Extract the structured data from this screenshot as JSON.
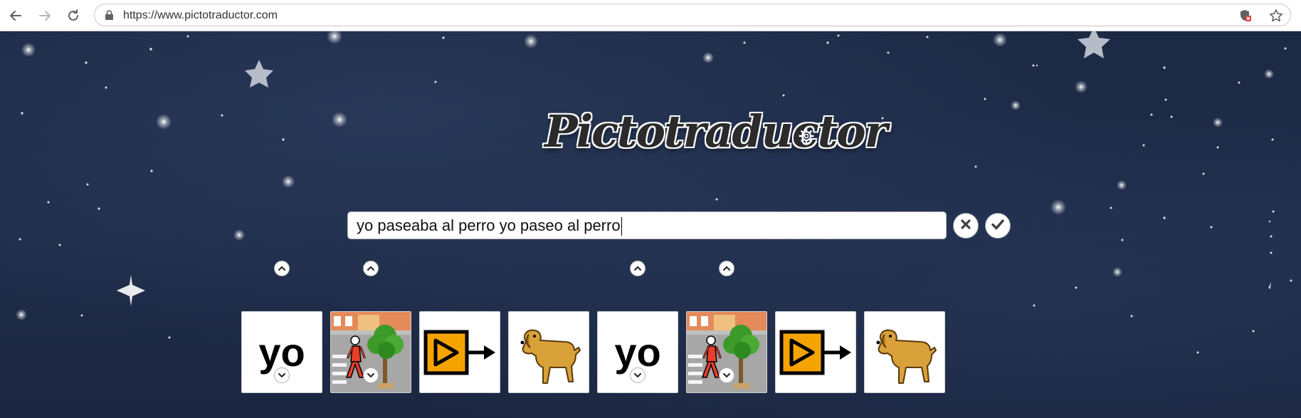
{
  "browser": {
    "url": "https://www.pictotraductor.com",
    "icons": [
      "back-arrow-icon",
      "forward-arrow-icon",
      "reload-icon",
      "lock-icon",
      "shield-extension-icon",
      "bookmark-star-icon"
    ]
  },
  "logo": {
    "text": "Pictotraductor"
  },
  "search": {
    "value": "yo paseaba al perro yo paseo al perro",
    "clear_icon": "close-icon",
    "submit_icon": "checkmark-icon"
  },
  "pictograms": [
    {
      "type": "text",
      "word": "yo"
    },
    {
      "type": "image",
      "depicts": "person-walking-street"
    },
    {
      "type": "image",
      "depicts": "past-tense-arrow"
    },
    {
      "type": "image",
      "depicts": "dog"
    },
    {
      "type": "text",
      "word": "yo"
    },
    {
      "type": "image",
      "depicts": "person-walking-street"
    },
    {
      "type": "image",
      "depicts": "past-tense-arrow"
    },
    {
      "type": "image",
      "depicts": "dog"
    }
  ],
  "colors": {
    "background": "#1e2a44",
    "tense_marker": "#f4a300"
  }
}
